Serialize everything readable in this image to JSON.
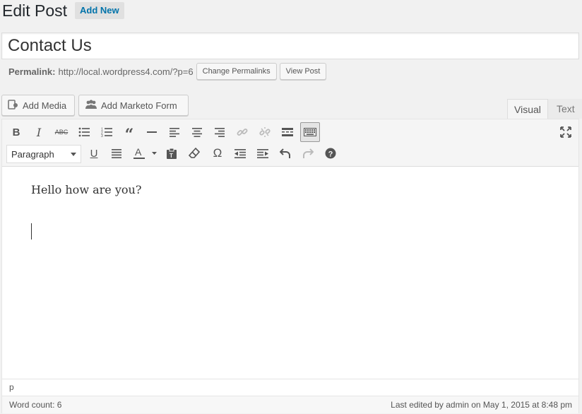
{
  "header": {
    "title": "Edit Post",
    "add_new_label": "Add New"
  },
  "post": {
    "title_value": "Contact Us"
  },
  "permalink": {
    "label": "Permalink:",
    "url": "http://local.wordpress4.com/?p=6",
    "change_label": "Change Permalinks",
    "view_label": "View Post"
  },
  "media_buttons": {
    "add_media": "Add Media",
    "add_marketo": "Add Marketo Form"
  },
  "tabs": {
    "visual": "Visual",
    "text": "Text"
  },
  "toolbar": {
    "row1": [
      "bold-icon",
      "italic-icon",
      "strikethrough-icon",
      "bullet-list-icon",
      "numbered-list-icon",
      "blockquote-icon",
      "horizontal-line-icon",
      "align-left-icon",
      "align-center-icon",
      "align-right-icon",
      "insert-link-icon",
      "remove-link-icon",
      "read-more-icon",
      "toolbar-toggle-icon"
    ],
    "row2": [
      "underline-icon",
      "justify-icon",
      "text-color-icon",
      "paste-text-icon",
      "clear-formatting-icon",
      "special-character-icon",
      "outdent-icon",
      "indent-icon",
      "undo-icon",
      "redo-icon",
      "help-icon"
    ],
    "format_value": "Paragraph",
    "fullscreen_icon": "fullscreen-icon"
  },
  "content": {
    "paragraph": "Hello how are you?"
  },
  "path_bar": {
    "path": "p"
  },
  "status": {
    "word_count": "Word count: 6",
    "last_edited": "Last edited by admin on May 1, 2015 at 8:48 pm"
  },
  "colors": {
    "link": "#0073aa",
    "toolbar_bg": "#f5f5f5",
    "page_bg": "#f1f1f1"
  }
}
